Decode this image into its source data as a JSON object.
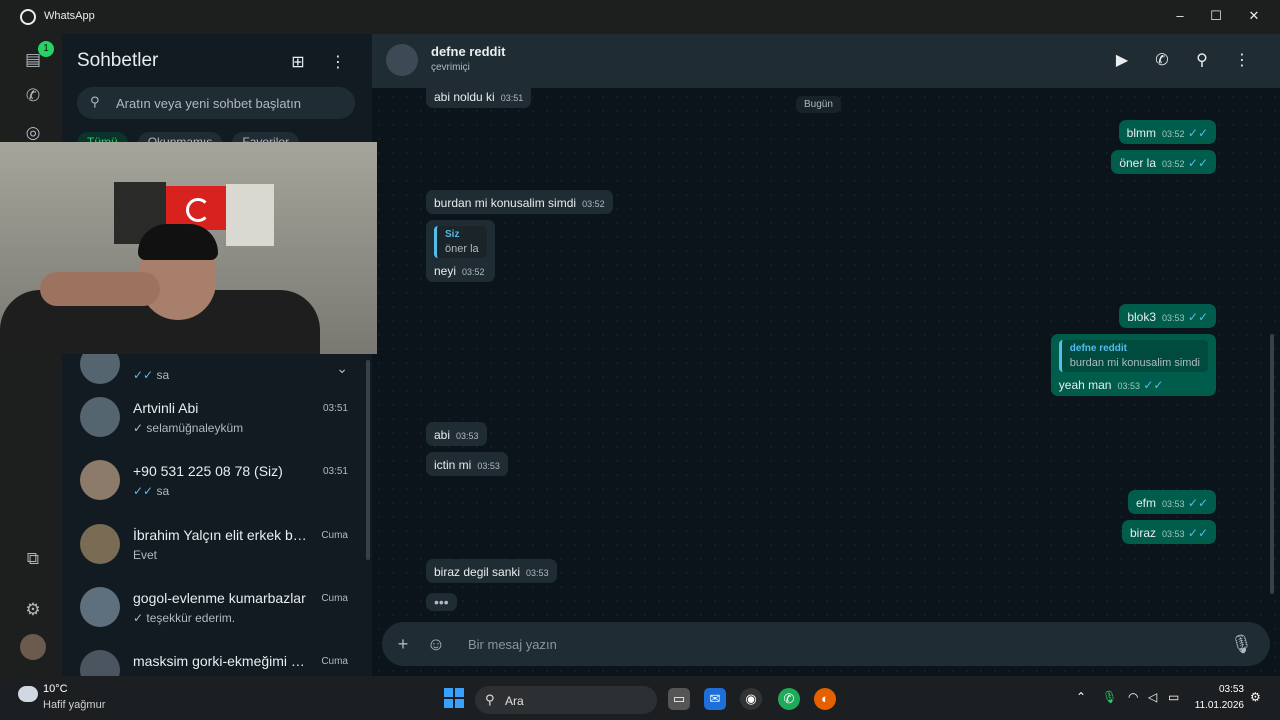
{
  "window": {
    "title": "WhatsApp",
    "minimize_icon": "–",
    "maximize_icon": "☐",
    "close_icon": "✕"
  },
  "rail": {
    "chats_badge": "1"
  },
  "sidebar": {
    "title": "Sohbetler",
    "search_placeholder": "Aratın veya yeni sohbet başlatın",
    "filters": [
      "Tümü",
      "Okunmamış",
      "Favoriler"
    ],
    "chats": [
      {
        "name": "",
        "time": "",
        "last": "sa",
        "ticks": "✓✓",
        "read": true
      },
      {
        "name": "Artvinli Abi",
        "time": "03:51",
        "last": "selamüğnaleyküm",
        "ticks": "✓",
        "read": false
      },
      {
        "name": "+90 531 225 08 78 (Siz)",
        "time": "03:51",
        "last": "sa",
        "ticks": "✓✓",
        "read": true
      },
      {
        "name": "İbrahim Yalçın elit erkek ber...",
        "time": "Cuma",
        "last": "Evet",
        "ticks": "",
        "read": false
      },
      {
        "name": "gogol-evlenme kumarbazlar",
        "time": "Cuma",
        "last": "teşekkür ederim.",
        "ticks": "✓",
        "read": false
      },
      {
        "name": "masksim gorki-ekmeğimi ka...",
        "time": "Cuma",
        "last": "",
        "ticks": "",
        "read": false
      }
    ]
  },
  "conversation": {
    "contact_name": "defne reddit",
    "status": "çevrimiçi",
    "date_chip": "Bugün",
    "messages": [
      {
        "dir": "in",
        "text": "abi noldu ki",
        "time": "03:51"
      },
      {
        "dir": "out",
        "text": "blmm",
        "time": "03:52",
        "ticks": "✓✓"
      },
      {
        "dir": "out",
        "text": "öner la",
        "time": "03:52",
        "ticks": "✓✓"
      },
      {
        "dir": "in",
        "text": "burdan mi konusalim simdi",
        "time": "03:52"
      },
      {
        "dir": "in",
        "text": "neyi",
        "time": "03:52",
        "quote_author": "Siz",
        "quote_text": "öner la"
      },
      {
        "dir": "out",
        "text": "blok3",
        "time": "03:53",
        "ticks": "✓✓"
      },
      {
        "dir": "out",
        "text": "yeah man",
        "time": "03:53",
        "ticks": "✓✓",
        "quote_author": "defne reddit",
        "quote_text": "burdan mi konusalim simdi"
      },
      {
        "dir": "in",
        "text": "abi",
        "time": "03:53"
      },
      {
        "dir": "in",
        "text": "ictin mi",
        "time": "03:53"
      },
      {
        "dir": "out",
        "text": "efm",
        "time": "03:53",
        "ticks": "✓✓"
      },
      {
        "dir": "out",
        "text": "biraz",
        "time": "03:53",
        "ticks": "✓✓"
      },
      {
        "dir": "in",
        "text": "biraz degil sanki",
        "time": "03:53"
      }
    ],
    "typing_indicator": "•••",
    "composer_placeholder": "Bir mesaj yazın"
  },
  "taskbar": {
    "weather_temp": "10°C",
    "weather_desc": "Hafif yağmur",
    "search_label": "Ara",
    "whatsapp_badge": "1",
    "time": "03:53",
    "date": "11.01.2026"
  },
  "colors": {
    "accent": "#25d366",
    "outgoing_bubble": "#005c4b",
    "incoming_bubble": "#202c33",
    "read_tick": "#53bdeb"
  },
  "icons": [
    "whatsapp-icon",
    "chats-icon",
    "calls-icon",
    "status-icon",
    "new-chat-icon",
    "menu-icon",
    "search-icon",
    "video-call-icon",
    "voice-call-icon",
    "attach-icon",
    "sticker-icon",
    "mic-icon",
    "settings-icon"
  ]
}
